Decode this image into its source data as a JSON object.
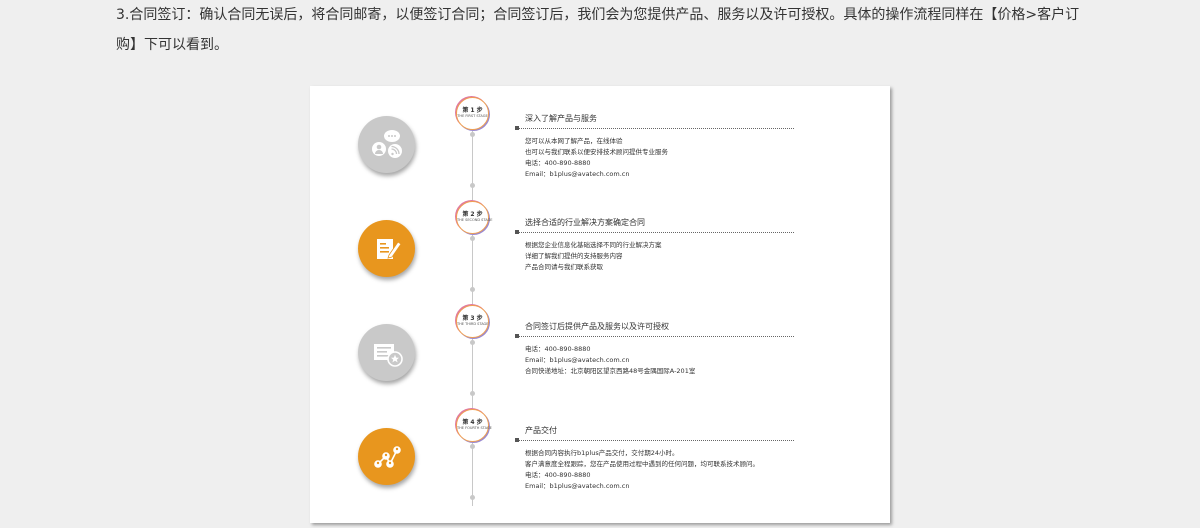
{
  "paragraph": {
    "text": "3.合同签订：确认合同无误后，将合同邮寄，以便签订合同；合同签订后，我们会为您提供产品、服务以及许可授权。具体的操作流程同样在【价格>客户订购】下可以看到。"
  },
  "stages": [
    {
      "step_label": "第 1 步",
      "step_sub": "THE FIRST STAGE",
      "icon": "chat-user-rss-icon",
      "color": "gray",
      "title": "深入了解产品与服务",
      "lines": [
        "您可以从本网了解产品，在线体验",
        "也可以与我们联系以便安排技术顾问提供专业服务",
        "电话：400-890-8880",
        "Email：b1plus@avatech.com.cn"
      ]
    },
    {
      "step_label": "第 2 步",
      "step_sub": "THE SECOND STAGE",
      "icon": "document-edit-icon",
      "color": "orange",
      "title": "选择合适的行业解决方案确定合同",
      "lines": [
        "根据您企业信息化基础选择不同的行业解决方案",
        "详细了解我们提供的支持服务内容",
        "产品合同请与我们联系获取"
      ]
    },
    {
      "step_label": "第 3 步",
      "step_sub": "THE THIRD STAGE",
      "icon": "certificate-icon",
      "color": "gray",
      "title": "合同签订后提供产品及服务以及许可授权",
      "lines": [
        "电话：400-890-8880",
        "Email：b1plus@avatech.com.cn",
        "合同快递地址：北京朝阳区望京西路48号金隅国际A-201室"
      ]
    },
    {
      "step_label": "第 4 步",
      "step_sub": "THE FOURTH STAGE",
      "icon": "network-users-icon",
      "color": "orange",
      "title": "产品交付",
      "lines": [
        "根据合同内容执行b1plus产品交付，交付期24小时。",
        "客户满意度全程跟踪，您在产品使用过程中遇到的任何问题，均可联系技术顾问。",
        "电话：400-890-8880",
        "Email：b1plus@avatech.com.cn"
      ]
    }
  ]
}
